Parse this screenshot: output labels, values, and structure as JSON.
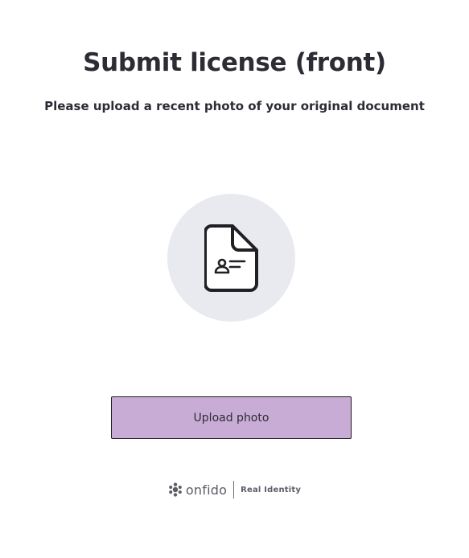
{
  "header": {
    "title": "Submit license (front)",
    "subtitle": "Please upload a recent photo of your original document"
  },
  "illustration": {
    "icon": "document-id-icon",
    "circle_color": "#e8eaef"
  },
  "actions": {
    "upload_label": "Upload photo",
    "button_color": "#c9acd6"
  },
  "footer": {
    "brand_name": "onfido",
    "tagline": "Real Identity",
    "logo_icon": "onfido-logo-icon"
  }
}
